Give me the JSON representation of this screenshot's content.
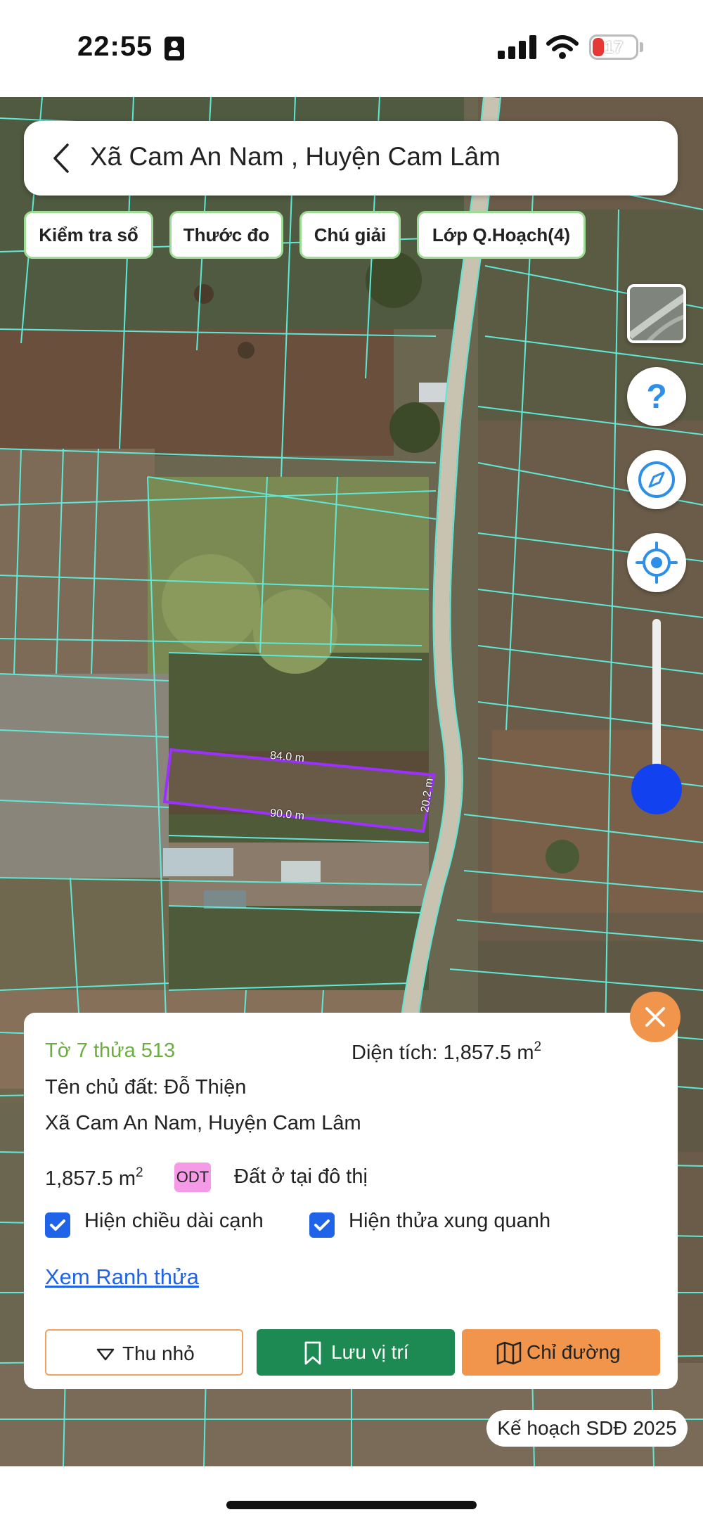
{
  "status_bar": {
    "time": "22:55",
    "battery_level": "17"
  },
  "search_bar": {
    "title": "Xã Cam An Nam , Huyện Cam Lâm"
  },
  "toolbar": {
    "check_label": "Kiểm tra sổ",
    "ruler_label": "Thước đo",
    "legend_label": "Chú giải",
    "layer_label": "Lớp Q.Hoạch(4)"
  },
  "map": {
    "edge_top": "84.0 m",
    "edge_bottom": "90.0 m",
    "edge_right": "20.2 m",
    "parcel_color": "#9b30ff",
    "boundary_color": "#5ee8d6"
  },
  "icons": {
    "back": "chevron-left-icon",
    "help": "question-icon",
    "compass": "compass-icon",
    "locate": "crosshair-icon",
    "close": "close-icon",
    "collapse": "triangle-down-icon",
    "save": "bookmark-icon",
    "directions": "map-icon"
  },
  "parcel_info": {
    "sheet_parcel": "Tờ 7 thửa 513",
    "area_label": "Diện tích: 1,857.5 m",
    "area_sup": "2",
    "owner": "Tên chủ đất: Đỗ Thiện",
    "address": "Xã Cam An Nam, Huyện Cam Lâm",
    "area_value": "1,857.5 m",
    "area_value_sup": "2",
    "land_code": "ODT",
    "land_type": "Đất ở tại đô thị",
    "show_edges_label": "Hiện chiều dài cạnh",
    "show_neighbors_label": "Hiện thửa xung quanh",
    "view_border_link": "Xem Ranh thửa"
  },
  "actions": {
    "collapse_label": "Thu nhỏ",
    "save_label": "Lưu vị trí",
    "directions_label": "Chỉ đường"
  },
  "plan_badge": "Kế hoạch SDĐ 2025",
  "colors": {
    "accent_green": "#1c8a52",
    "accent_orange": "#f2954c",
    "link_blue": "#1e63e8",
    "odt_pink": "#f59ae6"
  }
}
